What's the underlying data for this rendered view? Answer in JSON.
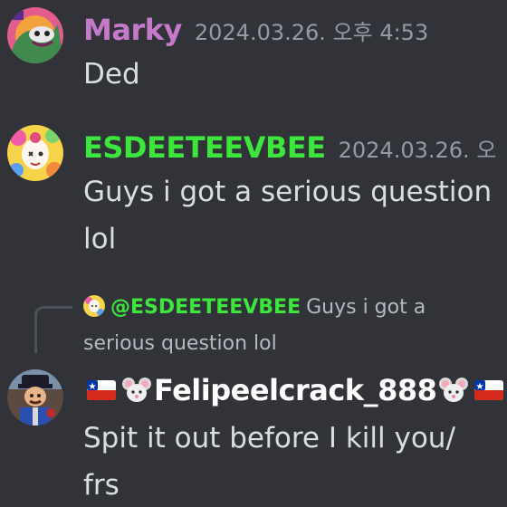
{
  "colors": {
    "background": "#313338",
    "text": "#dbdee1",
    "muted": "#949ba4",
    "marky_name": "#c47ac8",
    "esdee_name": "#3ce63c",
    "felipe_name": "#ffffff"
  },
  "messages": [
    {
      "author": "Marky",
      "timestamp": "2024.03.26. 오후 4:53",
      "lines": [
        "Ded"
      ]
    },
    {
      "author": "ESDEETEEVBEE",
      "timestamp": "2024.03.26. 오",
      "lines": [
        "Guys i got a serious question",
        "lol"
      ]
    },
    {
      "reply": {
        "mention": "@ESDEETEEVBEE",
        "text": "Guys i got a serious question lol"
      },
      "author_emoji": [
        "chile-flag-icon",
        "mouse-face-icon"
      ],
      "author": "Felipeelcrack_888",
      "lines": [
        "Spit it out before I kill you/",
        "frs"
      ]
    }
  ]
}
